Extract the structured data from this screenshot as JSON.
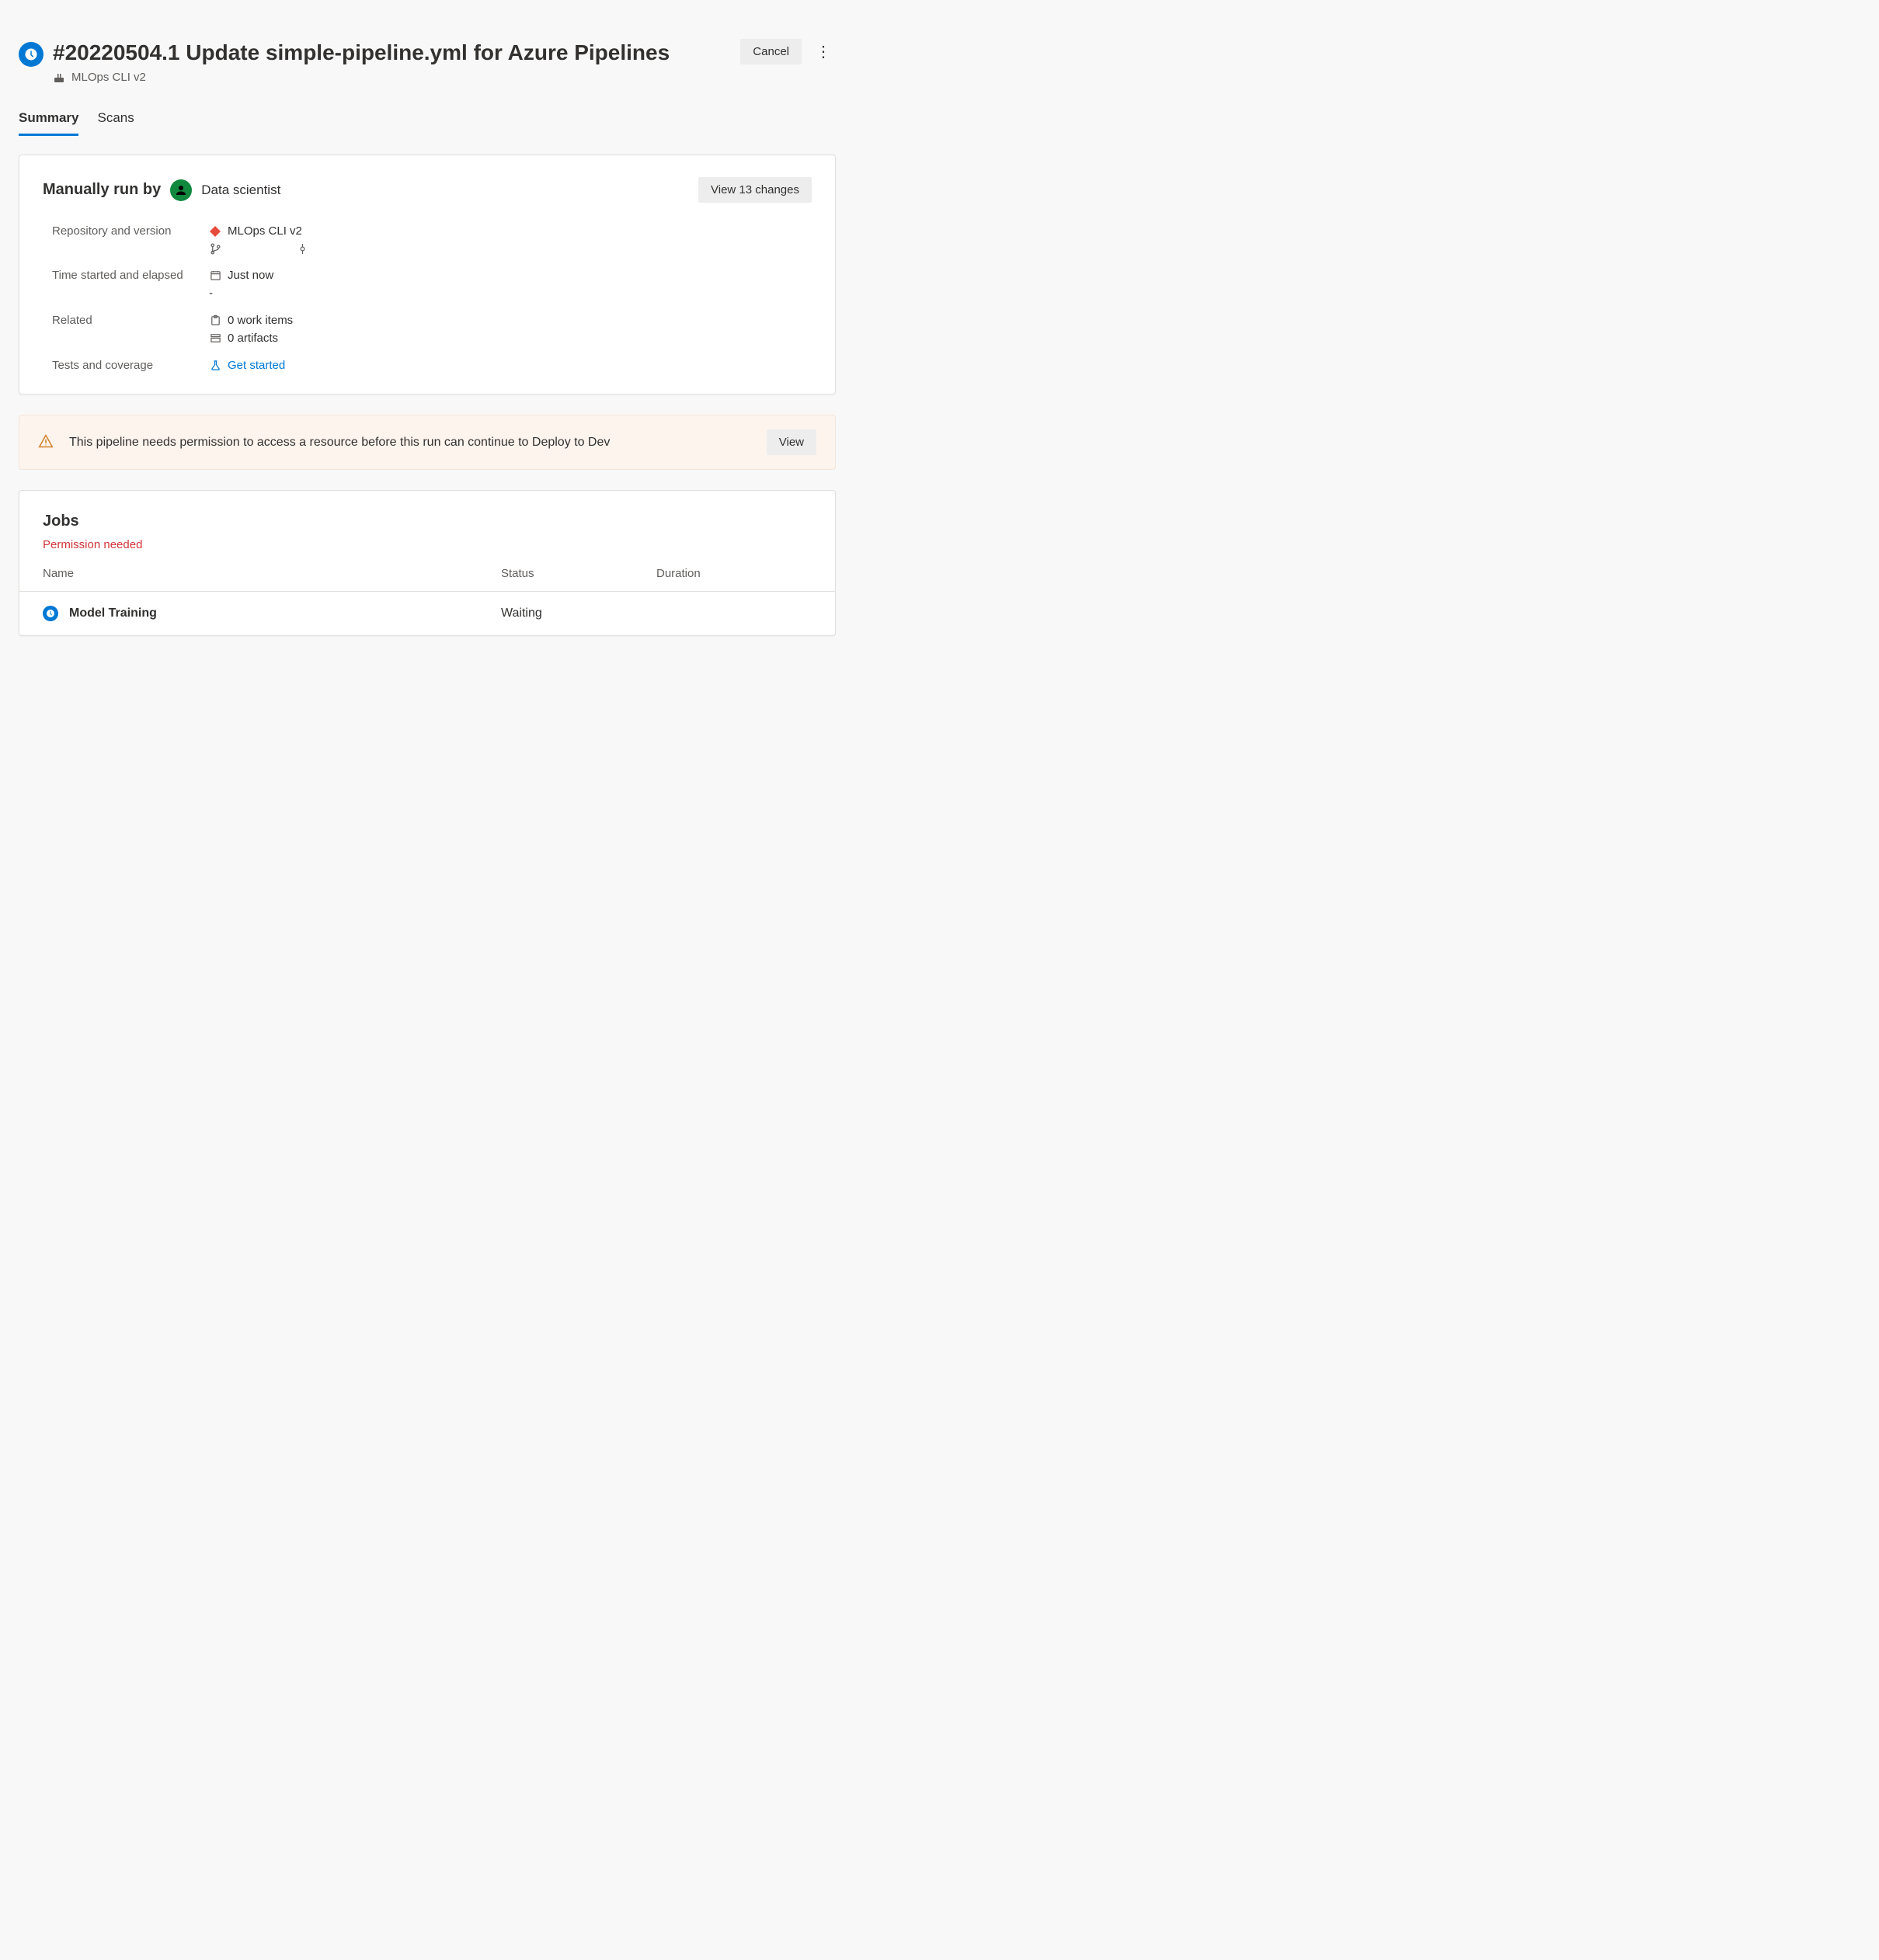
{
  "header": {
    "title": "#20220504.1 Update simple-pipeline.yml for Azure Pipelines",
    "pipeline_name": "MLOps CLI v2",
    "cancel_label": "Cancel"
  },
  "tabs": {
    "summary": "Summary",
    "scans": "Scans"
  },
  "summary": {
    "run_by_prefix": "Manually run by",
    "run_by_user": "Data scientist",
    "view_changes_label": "View 13 changes",
    "rows": {
      "repo_label": "Repository and version",
      "repo_value": "MLOps CLI v2",
      "time_label": "Time started and elapsed",
      "time_started": "Just now",
      "time_elapsed": "-",
      "related_label": "Related",
      "work_items": "0 work items",
      "artifacts": "0 artifacts",
      "tests_label": "Tests and coverage",
      "tests_link": "Get started"
    }
  },
  "banner": {
    "text": "This pipeline needs permission to access a resource before this run can continue to Deploy to Dev",
    "view_label": "View"
  },
  "jobs": {
    "title": "Jobs",
    "stage_status": "Permission needed",
    "columns": {
      "name": "Name",
      "status": "Status",
      "duration": "Duration"
    },
    "rows": [
      {
        "name": "Model Training",
        "status": "Waiting",
        "duration": ""
      }
    ]
  }
}
